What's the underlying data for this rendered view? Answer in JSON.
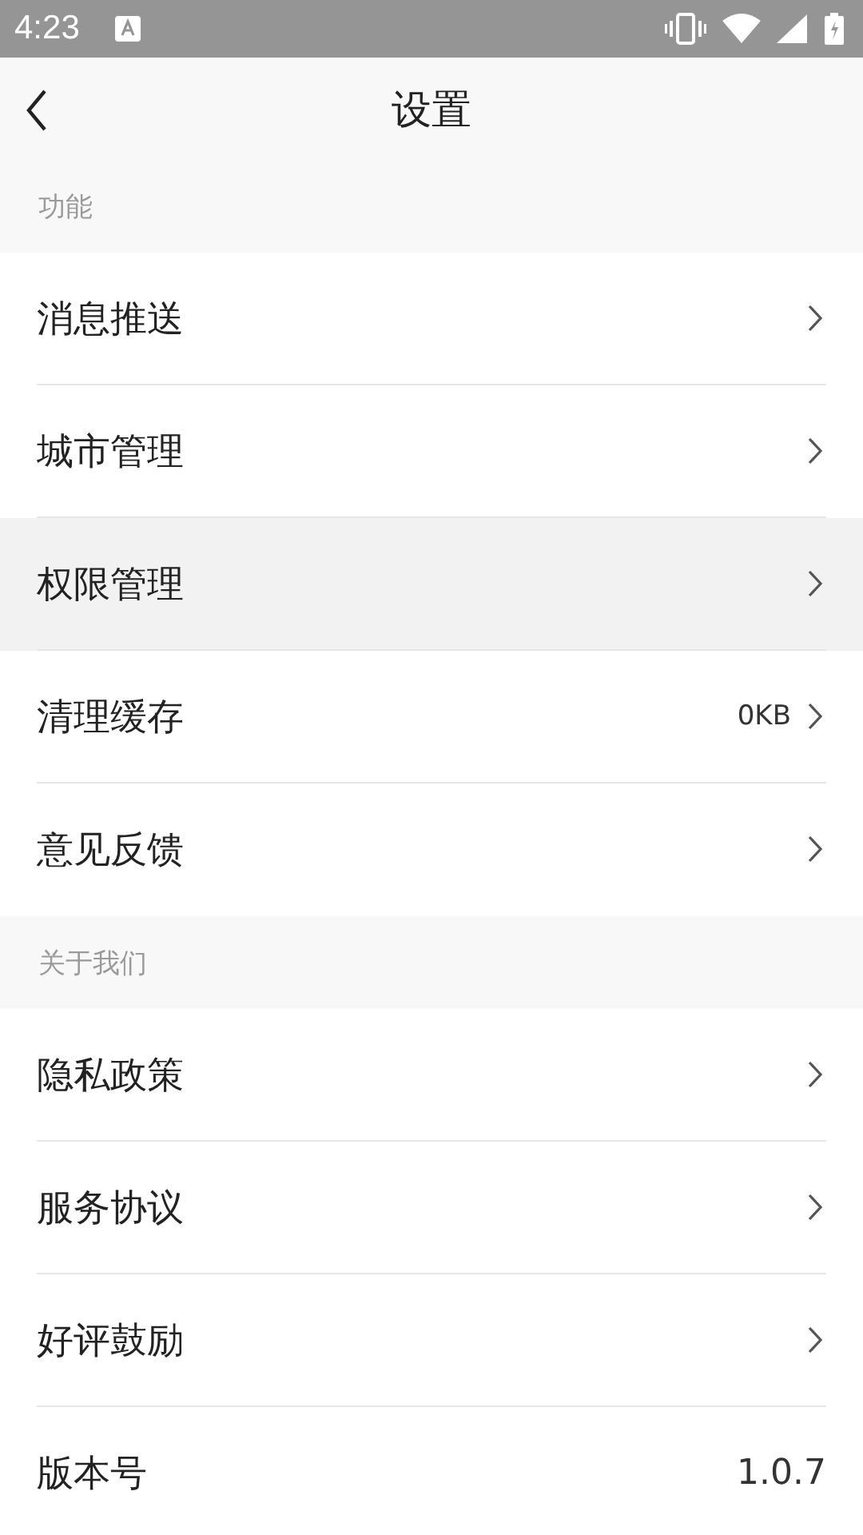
{
  "status_bar": {
    "time": "4:23"
  },
  "header": {
    "title": "设置"
  },
  "sections": [
    {
      "title": "功能",
      "items": [
        {
          "kind": "nav",
          "label": "消息推送",
          "selected": false
        },
        {
          "kind": "nav",
          "label": "城市管理",
          "selected": false
        },
        {
          "kind": "nav",
          "label": "权限管理",
          "selected": true
        },
        {
          "kind": "nav",
          "label": "清理缓存",
          "value": "0KB",
          "selected": false
        },
        {
          "kind": "nav",
          "label": "意见反馈",
          "selected": false
        }
      ]
    },
    {
      "title": "关于我们",
      "items": [
        {
          "kind": "nav",
          "label": "隐私政策",
          "selected": false
        },
        {
          "kind": "nav",
          "label": "服务协议",
          "selected": false
        },
        {
          "kind": "nav",
          "label": "好评鼓励",
          "selected": false
        },
        {
          "kind": "info",
          "label": "版本号",
          "value": "1.0.7",
          "selected": false
        }
      ]
    }
  ]
}
